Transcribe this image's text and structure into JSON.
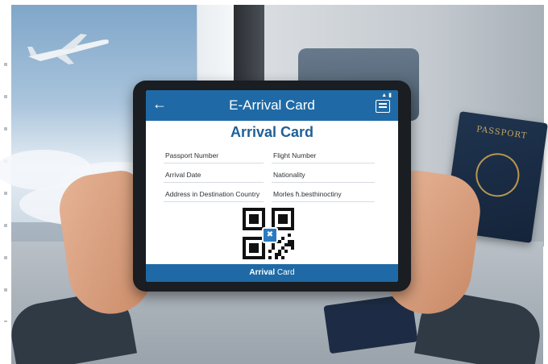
{
  "app": {
    "header_title": "E-Arrival Card",
    "back_icon": "arrow-left-icon",
    "menu_icon": "document-menu-icon"
  },
  "card": {
    "heading": "Arrival Card",
    "fields": {
      "passport_number": "Passport Number",
      "flight_number": "Flight Number",
      "arrival_date": "Arrival Date",
      "nationality": "Nationality",
      "address": "Address in Destination Country",
      "address_value": "Morles ħ.besthinoctiny"
    },
    "qr_icon": "qr-code-icon"
  },
  "footer": {
    "label_bold": "Arrival",
    "label_rest": " Card"
  },
  "scene": {
    "passport_label": "PASSPORT",
    "colors": {
      "accent": "#1f6aa6",
      "heading": "#1f5f97"
    }
  }
}
